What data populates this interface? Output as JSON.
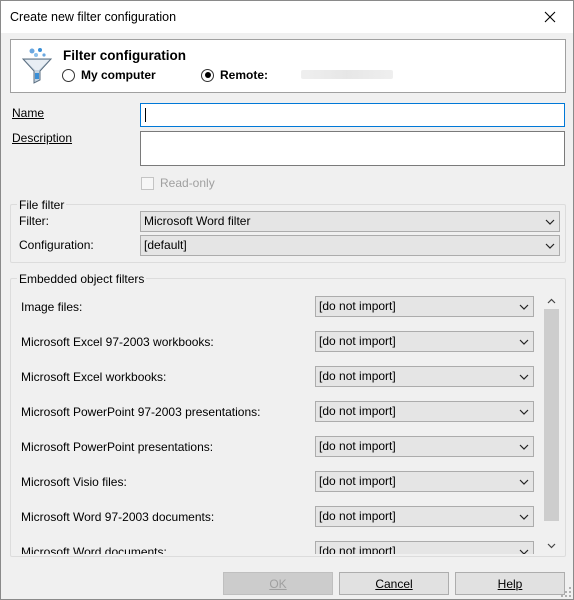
{
  "window": {
    "title": "Create new filter configuration"
  },
  "header": {
    "title": "Filter configuration",
    "radio_my_computer": "My computer",
    "radio_remote": "Remote:",
    "selected": "remote",
    "remote_host": ""
  },
  "form": {
    "name_label": "Name",
    "name_value": "",
    "description_label": "Description",
    "description_value": "",
    "readonly_label": "Read-only",
    "readonly_checked": false
  },
  "file_filter": {
    "group_label": "File filter",
    "filter_label": "Filter:",
    "filter_value": "Microsoft Word filter",
    "configuration_label": "Configuration:",
    "configuration_value": "[default]"
  },
  "embedded": {
    "group_label": "Embedded object filters",
    "rows": [
      {
        "label": "Image files:",
        "value": "[do not import]"
      },
      {
        "label": "Microsoft Excel 97-2003 workbooks:",
        "value": "[do not import]"
      },
      {
        "label": "Microsoft Excel workbooks:",
        "value": "[do not import]"
      },
      {
        "label": "Microsoft PowerPoint 97-2003 presentations:",
        "value": "[do not import]"
      },
      {
        "label": "Microsoft PowerPoint presentations:",
        "value": "[do not import]"
      },
      {
        "label": "Microsoft Visio files:",
        "value": "[do not import]"
      },
      {
        "label": "Microsoft Word 97-2003 documents:",
        "value": "[do not import]"
      },
      {
        "label": "Microsoft Word documents:",
        "value": "[do not import]"
      }
    ]
  },
  "buttons": {
    "ok": "OK",
    "cancel": "Cancel",
    "help": "Help",
    "ok_enabled": false
  },
  "colors": {
    "accent": "#0078d7",
    "funnel": "#3a8fd6"
  }
}
